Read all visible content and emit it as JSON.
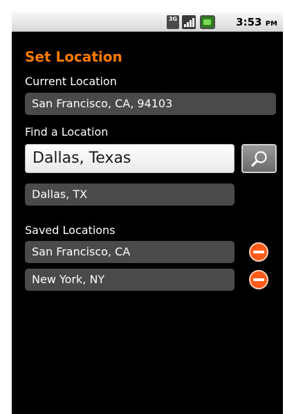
{
  "status_bar": {
    "network": "3G",
    "time": "3:53",
    "ampm": "PM",
    "icons": [
      "3g-icon",
      "signal-icon",
      "battery-icon"
    ]
  },
  "screen": {
    "title": "Set Location",
    "current_location": {
      "label": "Current Location",
      "value": "San Francisco, CA, 94103"
    },
    "find_location": {
      "label": "Find a Location",
      "input_value": "Dallas, Texas",
      "suggestion": "Dallas, TX"
    },
    "saved_locations": {
      "label": "Saved Locations",
      "items": [
        {
          "name": "San Francisco, CA"
        },
        {
          "name": "New York, NY"
        }
      ]
    }
  },
  "colors": {
    "accent": "#ff7a00",
    "background": "#000000",
    "field": "#4a4a4a",
    "remove": "#ff5a1a"
  }
}
